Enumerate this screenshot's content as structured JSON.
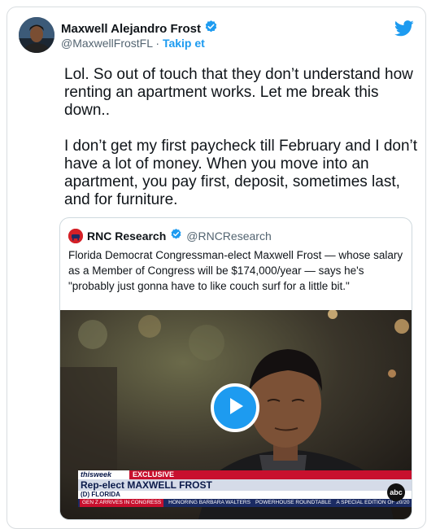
{
  "author": {
    "name": "Maxwell Alejandro Frost",
    "handle": "@MaxwellFrostFL",
    "separator": " · ",
    "follow_label": "Takip et"
  },
  "tweet": {
    "paragraph1": "Lol. So out of touch that they don’t understand how renting an apartment works. Let me break this down..",
    "paragraph2": "I don’t get my first paycheck till February and I don’t have a lot of money. When you move into an apartment, you pay first, deposit, sometimes last, and for furniture."
  },
  "quote": {
    "name": "RNC Research",
    "handle": "@RNCResearch",
    "text": "Florida Democrat Congressman-elect Maxwell Frost — whose salary as a Member of Congress will be $174,000/year — says he's \"probably just gonna have to like couch surf for a little bit.\""
  },
  "video": {
    "show": "thisweek",
    "tag": "EXCLUSIVE",
    "headline": "Rep-elect MAXWELL FROST",
    "subline": "(D) FLORIDA",
    "ticker": [
      "GEN Z ARRIVES IN CONGRESS",
      "HONORING BARBARA WALTERS",
      "POWERHOUSE ROUNDTABLE",
      "A SPECIAL EDITION OF 20/20"
    ],
    "network": "abc"
  },
  "icons": {
    "verified": "verified-badge-icon",
    "bird": "twitter-bird-icon",
    "play": "play-icon"
  },
  "colors": {
    "accent": "#1d9bf0",
    "text": "#0f1419",
    "muted": "#536471"
  }
}
